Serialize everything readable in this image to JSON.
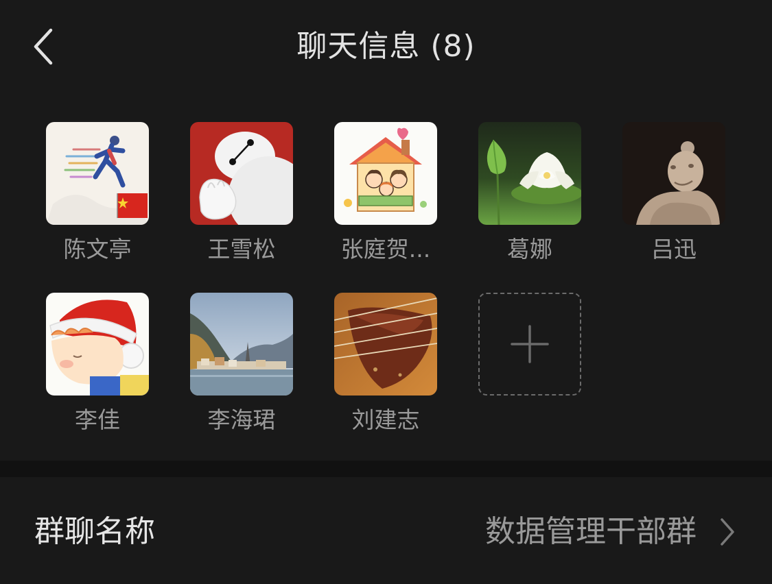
{
  "header": {
    "title": "聊天信息 (8)",
    "back_icon": "chevron-left-icon"
  },
  "members": [
    {
      "name": "陈文亭",
      "avatar": "runner-flag-avatar"
    },
    {
      "name": "王雪松",
      "avatar": "white-robot-avatar"
    },
    {
      "name": "张庭贺...",
      "avatar": "cartoon-house-family-avatar"
    },
    {
      "name": "葛娜",
      "avatar": "lotus-flower-avatar"
    },
    {
      "name": "吕迅",
      "avatar": "terracotta-figure-avatar"
    },
    {
      "name": "李佳",
      "avatar": "santa-hat-child-avatar"
    },
    {
      "name": "李海珺",
      "avatar": "lakeside-village-avatar"
    },
    {
      "name": "刘建志",
      "avatar": "guitar-pick-avatar"
    }
  ],
  "add_member": {
    "icon": "plus-icon"
  },
  "group_settings": {
    "name_label": "群聊名称",
    "name_value": "数据管理干部群",
    "chevron_icon": "chevron-right-icon"
  },
  "colors": {
    "background": "#111111",
    "panel": "#191919",
    "primary_text": "#e6e6e6",
    "secondary_text": "#9a9a9a"
  }
}
